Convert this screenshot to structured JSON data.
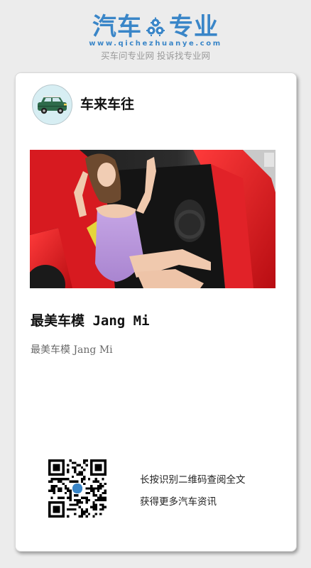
{
  "brand": {
    "word_left": "汽车",
    "word_right": "专业",
    "domain": "www.qichezhuanye.com",
    "slogan": "买车问专业网 投诉找专业网",
    "color": "#3a86c8"
  },
  "card": {
    "channel_name": "车来车往",
    "article_title": "最美车模 Jang Mi",
    "article_description": "最美车模 Jang Mi",
    "qr_line1": "长按识别二维码查阅全文",
    "qr_line2": "获得更多汽车资讯",
    "accent_car_color": "#e01b24"
  },
  "icons": {
    "avatar": "green-car-icon",
    "brand_mark": "gear-icon",
    "qr": "qr-code-icon"
  }
}
